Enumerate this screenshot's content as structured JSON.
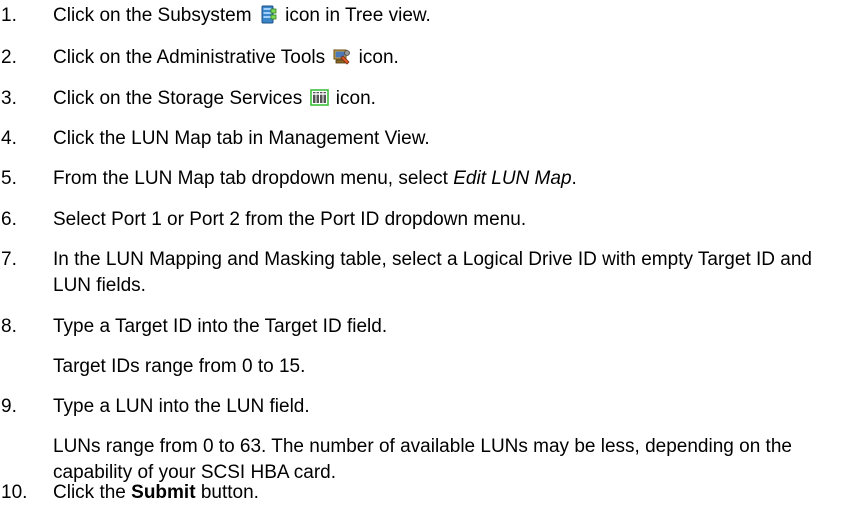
{
  "steps": [
    {
      "num": "1.",
      "pre": "Click on the Subsystem",
      "icon": "subsystem-icon",
      "post": "icon in Tree view."
    },
    {
      "num": "2.",
      "pre": "Click on the Administrative Tools",
      "icon": "administrative-tools-icon",
      "post": "icon."
    },
    {
      "num": "3.",
      "pre": "Click on the Storage Services",
      "icon": "storage-services-icon",
      "post": "icon."
    },
    {
      "num": "4.",
      "text": "Click the LUN Map tab in Management View."
    },
    {
      "num": "5.",
      "pre": "From the LUN Map tab dropdown menu, select",
      "em": "Edit LUN Map",
      "post": "."
    },
    {
      "num": "6.",
      "text": "Select Port 1 or Port 2 from the Port ID dropdown menu."
    },
    {
      "num": "7.",
      "text": "In the LUN Mapping and Masking table, select a Logical Drive ID with empty Target ID and LUN fields."
    },
    {
      "num": "8.",
      "text": "Type a Target ID into the Target ID field.",
      "note": "Target IDs range from 0 to 15."
    },
    {
      "num": "9.",
      "text": "Type a LUN into the LUN field.",
      "note": "LUNs range from 0 to 63. The number of available LUNs may be less, depending on the capability of your SCSI HBA card."
    },
    {
      "num": "10.",
      "pre": "Click the",
      "bold": "Submit",
      "post": "button."
    }
  ]
}
